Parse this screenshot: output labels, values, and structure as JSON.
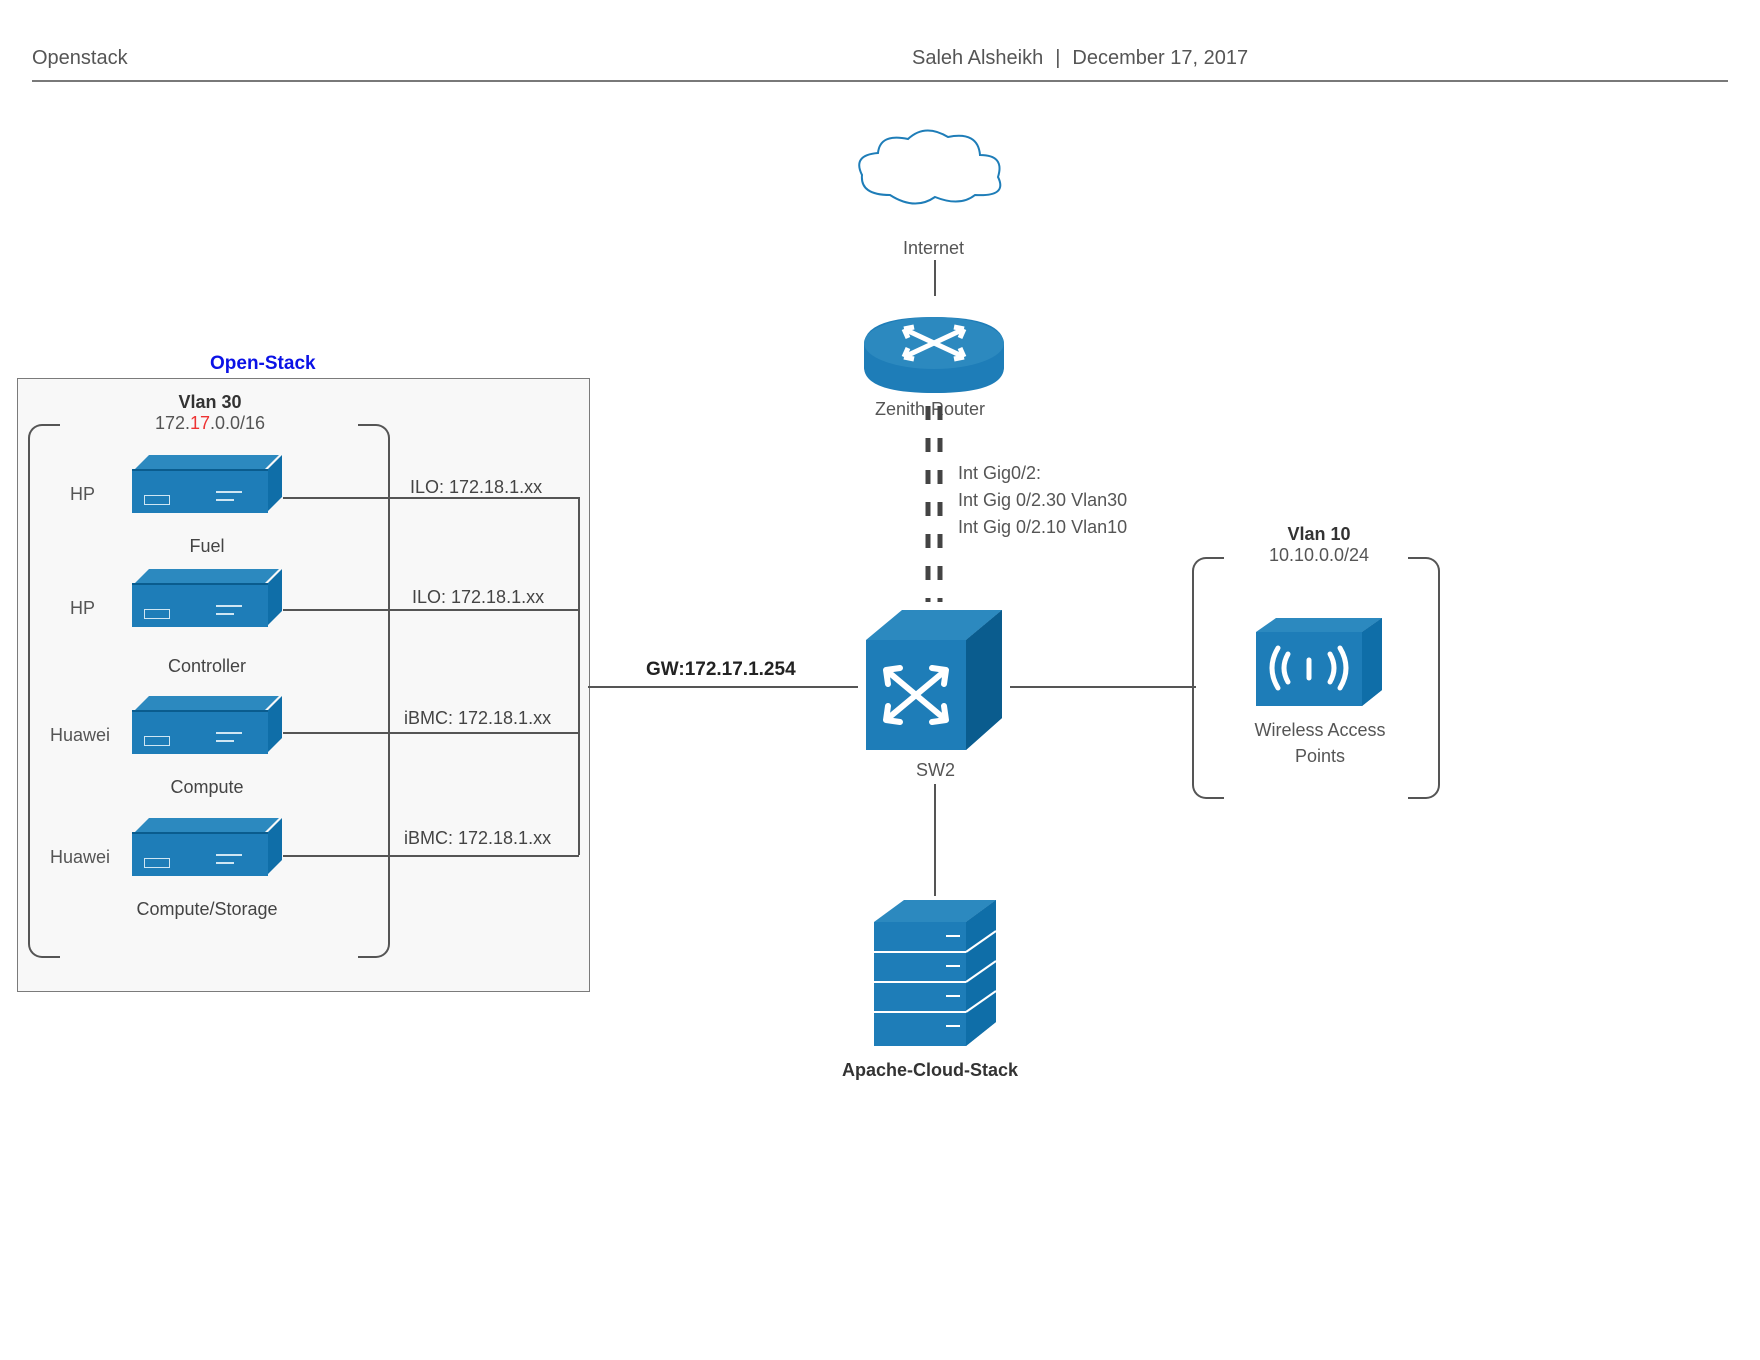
{
  "header": {
    "title": "Openstack",
    "author": "Saleh Alsheikh",
    "sep": "|",
    "date": "December 17, 2017"
  },
  "openstack_title": "Open-Stack",
  "vlan30": {
    "title": "Vlan 30",
    "subnet_pre": "172.",
    "subnet_mid": "17",
    "subnet_post": ".0.0/16"
  },
  "servers": [
    {
      "vendor": "HP",
      "name": "Fuel",
      "mgmt": "ILO: 172.18.1.xx"
    },
    {
      "vendor": "HP",
      "name": "Controller",
      "mgmt": "ILO: 172.18.1.xx"
    },
    {
      "vendor": "Huawei",
      "name": "Compute",
      "mgmt": "iBMC: 172.18.1.xx"
    },
    {
      "vendor": "Huawei",
      "name": "Compute/Storage",
      "mgmt": "iBMC: 172.18.1.xx"
    }
  ],
  "gateway": "GW:172.17.1.254",
  "int_gig": {
    "l1": "Int Gig0/2:",
    "l2": "Int Gig 0/2.30 Vlan30",
    "l3": "Int Gig 0/2.10 Vlan10"
  },
  "internet": "Internet",
  "router": "Zenith-Router",
  "sw2": "SW2",
  "apache": "Apache-Cloud-Stack",
  "vlan10": {
    "title": "Vlan 10",
    "subnet": "10.10.0.0/24"
  },
  "wap": {
    "l1": "Wireless Access",
    "l2": "Points"
  }
}
